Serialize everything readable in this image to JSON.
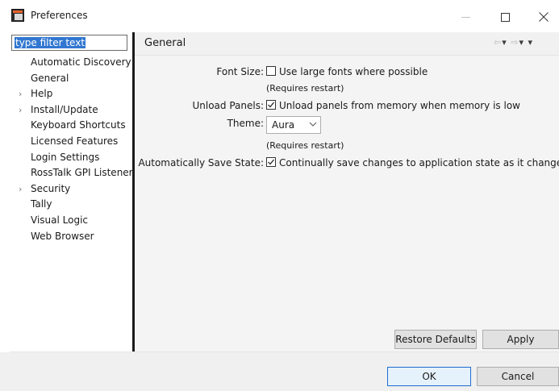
{
  "window": {
    "title": "Preferences",
    "controls": {
      "minimize": "—",
      "maximize": "☐",
      "close": "✕"
    }
  },
  "sidebar": {
    "filter": {
      "value": "type filter text"
    },
    "items": [
      {
        "label": "Automatic Discovery",
        "expandable": false,
        "selected": false
      },
      {
        "label": "General",
        "expandable": false,
        "selected": true
      },
      {
        "label": "Help",
        "expandable": true,
        "selected": false
      },
      {
        "label": "Install/Update",
        "expandable": true,
        "selected": false
      },
      {
        "label": "Keyboard Shortcuts",
        "expandable": false,
        "selected": false
      },
      {
        "label": "Licensed Features",
        "expandable": false,
        "selected": false
      },
      {
        "label": "Login Settings",
        "expandable": false,
        "selected": false
      },
      {
        "label": "RossTalk GPI Listener",
        "expandable": false,
        "selected": false
      },
      {
        "label": "Security",
        "expandable": true,
        "selected": false
      },
      {
        "label": "Tally",
        "expandable": false,
        "selected": false
      },
      {
        "label": "Visual Logic",
        "expandable": false,
        "selected": false
      },
      {
        "label": "Web Browser",
        "expandable": false,
        "selected": false
      }
    ]
  },
  "page": {
    "title": "General",
    "nav_icons": [
      "back-arrow-icon",
      "back-menu-icon",
      "forward-arrow-icon",
      "forward-menu-icon",
      "view-menu-icon"
    ],
    "font_size": {
      "label": "Font Size:",
      "checkbox_label": "Use large fonts where possible",
      "checked": false,
      "note": "(Requires restart)"
    },
    "unload_panels": {
      "label": "Unload Panels:",
      "checkbox_label": "Unload panels from memory when memory is low",
      "checked": true
    },
    "theme": {
      "label": "Theme:",
      "value": "Aura",
      "note": "(Requires restart)"
    },
    "auto_save": {
      "label": "Automatically Save State:",
      "checkbox_label": "Continually save changes to application state as it changes",
      "checked": true
    },
    "buttons": {
      "restore": "Restore Defaults",
      "apply": "Apply"
    }
  },
  "footer": {
    "ok": "OK",
    "cancel": "Cancel"
  },
  "colors": {
    "selection": "#3177d1",
    "ok_border": "#1c6ed1",
    "panel_bg": "#f4f4f4",
    "splitter": "#1a1a1a"
  }
}
